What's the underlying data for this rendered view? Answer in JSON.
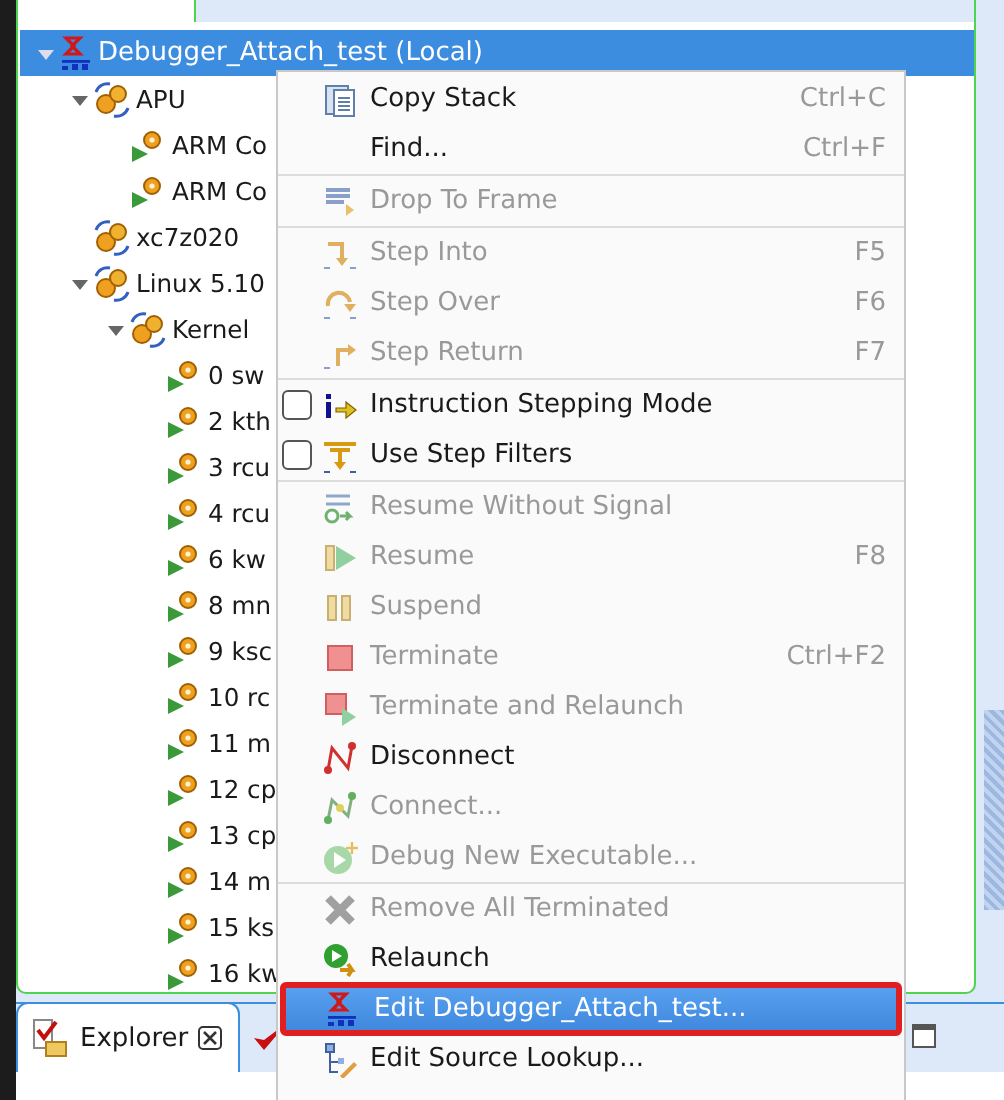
{
  "tree": [
    {
      "label": "Debugger_Attach_test (Local)",
      "kind": "launch",
      "selected": true,
      "expanded": true,
      "children": [
        {
          "label": "APU",
          "kind": "context",
          "selected": false,
          "expanded": true,
          "children": [
            {
              "label": "ARM Co",
              "kind": "thread",
              "selected": false
            },
            {
              "label": "ARM Co",
              "kind": "thread",
              "selected": false
            }
          ]
        },
        {
          "label": "xc7z020",
          "kind": "context",
          "selected": false
        },
        {
          "label": "Linux 5.10",
          "kind": "context",
          "selected": false,
          "expanded": true,
          "children": [
            {
              "label": "Kernel",
              "kind": "context",
              "selected": false,
              "expanded": true,
              "children": [
                {
                  "label": "0 sw",
                  "kind": "thread",
                  "selected": false
                },
                {
                  "label": "2 kth",
                  "kind": "thread",
                  "selected": false
                },
                {
                  "label": "3 rcu",
                  "kind": "thread",
                  "selected": false
                },
                {
                  "label": "4 rcu",
                  "kind": "thread",
                  "selected": false
                },
                {
                  "label": "6 kw",
                  "kind": "thread",
                  "selected": false
                },
                {
                  "label": "8 mn",
                  "kind": "thread",
                  "selected": false
                },
                {
                  "label": "9 ksc",
                  "kind": "thread",
                  "selected": false
                },
                {
                  "label": "10 rc",
                  "kind": "thread",
                  "selected": false
                },
                {
                  "label": "11 m",
                  "kind": "thread",
                  "selected": false
                },
                {
                  "label": "12 cp",
                  "kind": "thread",
                  "selected": false
                },
                {
                  "label": "13 cp",
                  "kind": "thread",
                  "selected": false
                },
                {
                  "label": "14 m",
                  "kind": "thread",
                  "selected": false
                },
                {
                  "label": "15 ks",
                  "kind": "thread",
                  "selected": false
                },
                {
                  "label": "16 kw",
                  "kind": "thread",
                  "selected": false
                }
              ]
            }
          ]
        }
      ]
    }
  ],
  "context_menu": [
    {
      "kind": "item",
      "label": "Copy Stack",
      "shortcut": "Ctrl+C",
      "disabled": false,
      "selected": false
    },
    {
      "kind": "item",
      "label": "Find...",
      "shortcut": "Ctrl+F",
      "disabled": false,
      "selected": false
    },
    {
      "kind": "separator"
    },
    {
      "kind": "item",
      "label": "Drop To Frame",
      "disabled": true,
      "selected": false
    },
    {
      "kind": "separator"
    },
    {
      "kind": "item",
      "label": "Step Into",
      "shortcut": "F5",
      "disabled": true,
      "selected": false
    },
    {
      "kind": "item",
      "label": "Step Over",
      "shortcut": "F6",
      "disabled": true,
      "selected": false
    },
    {
      "kind": "item",
      "label": "Step Return",
      "shortcut": "F7",
      "disabled": true,
      "selected": false
    },
    {
      "kind": "separator"
    },
    {
      "kind": "check",
      "label": "Instruction Stepping Mode",
      "checked": false,
      "disabled": false,
      "selected": false
    },
    {
      "kind": "check",
      "label": "Use Step Filters",
      "checked": false,
      "disabled": false,
      "selected": false
    },
    {
      "kind": "separator"
    },
    {
      "kind": "item",
      "label": "Resume Without Signal",
      "disabled": true,
      "selected": false
    },
    {
      "kind": "item",
      "label": "Resume",
      "shortcut": "F8",
      "disabled": true,
      "selected": false
    },
    {
      "kind": "item",
      "label": "Suspend",
      "disabled": true,
      "selected": false
    },
    {
      "kind": "item",
      "label": "Terminate",
      "shortcut": "Ctrl+F2",
      "disabled": true,
      "selected": false
    },
    {
      "kind": "item",
      "label": "Terminate and Relaunch",
      "disabled": true,
      "selected": false
    },
    {
      "kind": "item",
      "label": "Disconnect",
      "disabled": false,
      "selected": false
    },
    {
      "kind": "item",
      "label": "Connect...",
      "disabled": true,
      "selected": false
    },
    {
      "kind": "item",
      "label": "Debug New Executable...",
      "disabled": true,
      "selected": false
    },
    {
      "kind": "separator"
    },
    {
      "kind": "item",
      "label": "Remove All Terminated",
      "disabled": true,
      "selected": false
    },
    {
      "kind": "item",
      "label": "Relaunch",
      "disabled": false,
      "selected": false
    },
    {
      "kind": "item",
      "label": "Edit Debugger_Attach_test...",
      "disabled": false,
      "selected": true
    },
    {
      "kind": "item",
      "label": "Edit Source Lookup...",
      "disabled": false,
      "selected": false
    }
  ],
  "bottom_tabs": [
    {
      "label": "Explorer",
      "selected": true
    }
  ]
}
